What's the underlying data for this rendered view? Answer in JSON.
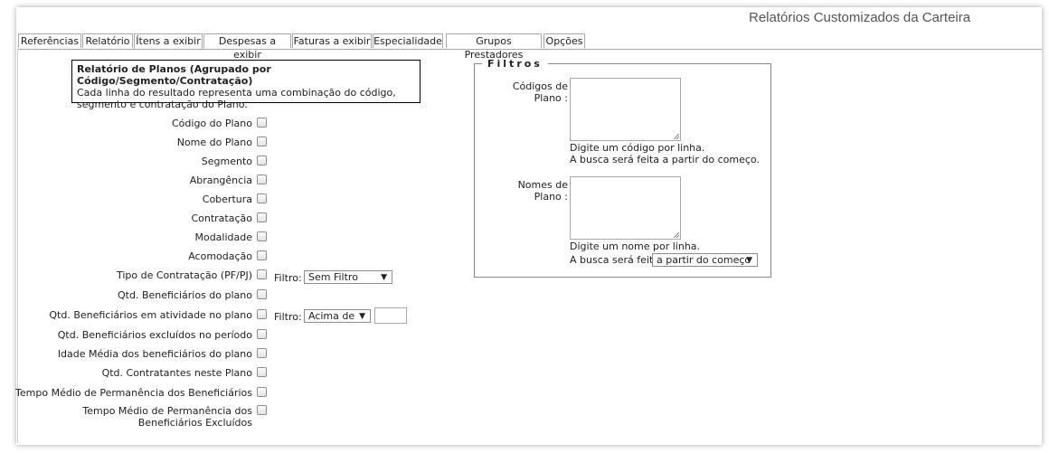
{
  "header": {
    "title": "Relatórios Customizados da Carteira"
  },
  "tabs": [
    {
      "label": "Referências"
    },
    {
      "label": "Relatório"
    },
    {
      "label": "Ítens a exibir"
    },
    {
      "label": "Despesas a exibir"
    },
    {
      "label": "Faturas a exibir"
    },
    {
      "label": "Especialidade"
    },
    {
      "label": "Grupos Prestadores"
    },
    {
      "label": "Opções"
    }
  ],
  "info": {
    "title": "Relatório de Planos (Agrupado por Código/Segmento/Contratação)",
    "desc": "Cada linha do resultado representa uma combinação do código, segmento e contratação do Plano."
  },
  "items": [
    {
      "label": "Código do Plano"
    },
    {
      "label": "Nome do Plano"
    },
    {
      "label": "Segmento"
    },
    {
      "label": "Abrangência"
    },
    {
      "label": "Cobertura"
    },
    {
      "label": "Contratação"
    },
    {
      "label": "Modalidade"
    },
    {
      "label": "Acomodação"
    },
    {
      "label": "Tipo de Contratação (PF/PJ)"
    },
    {
      "label": "Qtd. Beneficiários do plano"
    },
    {
      "label": "Qtd. Beneficiários em atividade no plano"
    },
    {
      "label": "Qtd. Beneficiários excluídos no período"
    },
    {
      "label": "Idade Média dos beneficiários do plano"
    },
    {
      "label": "Qtd. Contratantes neste Plano"
    },
    {
      "label": "Tempo Médio de Permanência dos Beneficiários"
    },
    {
      "label": "Tempo Médio de Permanência dos Beneficiários Excluídos"
    }
  ],
  "row_filters": {
    "filtro_label": "Filtro:",
    "tipo_contratacao_value": "Sem Filtro",
    "ativos_value": "Acima de",
    "ativos_input": ""
  },
  "filters": {
    "legend": "Filtros",
    "codigos_label": "Códigos de Plano :",
    "codigos_help_1": "Digite um código por linha.",
    "codigos_help_2": "A busca será feita a partir do começo.",
    "nomes_label": "Nomes de Plano :",
    "nomes_help_1": "Digite um nome por linha.",
    "nomes_help_2": "A busca será feita",
    "nomes_mode": "a partir do começo"
  }
}
